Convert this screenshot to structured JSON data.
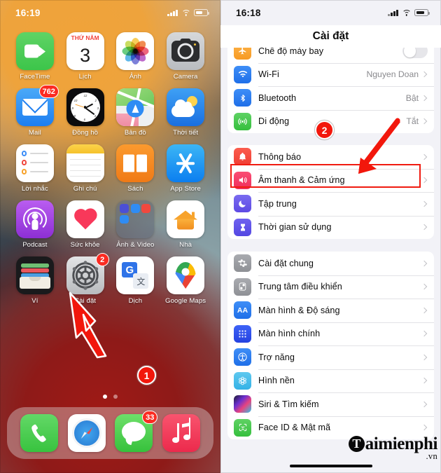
{
  "left_phone": {
    "status_bar": {
      "time": "16:19",
      "signal_icon": "cellular-signal-icon",
      "wifi_icon": "wifi-icon",
      "battery_icon": "battery-icon"
    },
    "apps": [
      {
        "label": "FaceTime",
        "icon": "facetime-icon",
        "badge": null
      },
      {
        "label": "Lịch",
        "icon": "calendar-icon",
        "badge": null,
        "cal_weekday": "THỨ NĂM",
        "cal_day": "3"
      },
      {
        "label": "Ảnh",
        "icon": "photos-icon",
        "badge": null
      },
      {
        "label": "Camera",
        "icon": "camera-icon",
        "badge": null
      },
      {
        "label": "Mail",
        "icon": "mail-icon",
        "badge": "762"
      },
      {
        "label": "Đồng hồ",
        "icon": "clock-icon",
        "badge": null
      },
      {
        "label": "Bản đồ",
        "icon": "maps-icon",
        "badge": null
      },
      {
        "label": "Thời tiết",
        "icon": "weather-icon",
        "badge": null
      },
      {
        "label": "Lời nhắc",
        "icon": "reminders-icon",
        "badge": null
      },
      {
        "label": "Ghi chú",
        "icon": "notes-icon",
        "badge": null
      },
      {
        "label": "Sách",
        "icon": "books-icon",
        "badge": null
      },
      {
        "label": "App Store",
        "icon": "app-store-icon",
        "badge": null
      },
      {
        "label": "Podcast",
        "icon": "podcasts-icon",
        "badge": null
      },
      {
        "label": "Sức khỏe",
        "icon": "health-icon",
        "badge": null
      },
      {
        "label": "Ảnh & Video",
        "icon": "folder-icon",
        "badge": null
      },
      {
        "label": "Nhà",
        "icon": "home-app-icon",
        "badge": null
      },
      {
        "label": "Ví",
        "icon": "wallet-icon",
        "badge": null
      },
      {
        "label": "Cài đặt",
        "icon": "settings-gear-icon",
        "badge": "2"
      },
      {
        "label": "Dịch",
        "icon": "translate-icon",
        "badge": null
      },
      {
        "label": "Google Maps",
        "icon": "google-maps-icon",
        "badge": null
      }
    ],
    "dock": [
      {
        "label": "Phone",
        "icon": "phone-icon",
        "badge": null
      },
      {
        "label": "Safari",
        "icon": "safari-icon",
        "badge": null
      },
      {
        "label": "Messages",
        "icon": "messages-icon",
        "badge": "33"
      },
      {
        "label": "Music",
        "icon": "music-icon",
        "badge": null
      }
    ],
    "page_dots": {
      "count": 2,
      "active": 1
    },
    "annotation": {
      "number": "1",
      "arrow": "red-arrow",
      "highlight_target": "Cài đặt"
    }
  },
  "right_phone": {
    "status_bar": {
      "time": "16:18",
      "signal_icon": "cellular-signal-icon",
      "wifi_icon": "wifi-icon",
      "battery_icon": "battery-icon"
    },
    "title": "Cài đặt",
    "groups": [
      {
        "rows": [
          {
            "label": "Chế độ máy bay",
            "icon": "airplane-icon",
            "value": "",
            "control": "toggle-off",
            "clipped": true
          },
          {
            "label": "Wi-Fi",
            "icon": "wifi-icon",
            "value": "Nguyen Doan",
            "control": "chevron"
          },
          {
            "label": "Bluetooth",
            "icon": "bluetooth-icon",
            "value": "Bật",
            "control": "chevron"
          },
          {
            "label": "Di động",
            "icon": "cellular-icon",
            "value": "Tắt",
            "control": "chevron"
          }
        ]
      },
      {
        "rows": [
          {
            "label": "Thông báo",
            "icon": "notifications-bell-icon",
            "value": "",
            "control": "chevron"
          },
          {
            "label": "Âm thanh & Cảm ứng",
            "icon": "sounds-haptics-icon",
            "value": "",
            "control": "chevron",
            "highlighted": true
          },
          {
            "label": "Tập trung",
            "icon": "focus-moon-icon",
            "value": "",
            "control": "chevron"
          },
          {
            "label": "Thời gian sử dụng",
            "icon": "screen-time-icon",
            "value": "",
            "control": "chevron"
          }
        ]
      },
      {
        "rows": [
          {
            "label": "Cài đặt chung",
            "icon": "general-gear-icon",
            "value": "",
            "control": "chevron"
          },
          {
            "label": "Trung tâm điều khiển",
            "icon": "control-center-icon",
            "value": "",
            "control": "chevron"
          },
          {
            "label": "Màn hình & Độ sáng",
            "icon": "display-brightness-icon",
            "value": "",
            "control": "chevron"
          },
          {
            "label": "Màn hình chính",
            "icon": "home-screen-icon",
            "value": "",
            "control": "chevron"
          },
          {
            "label": "Trợ năng",
            "icon": "accessibility-icon",
            "value": "",
            "control": "chevron"
          },
          {
            "label": "Hình nền",
            "icon": "wallpaper-icon",
            "value": "",
            "control": "chevron"
          },
          {
            "label": "Siri & Tìm kiếm",
            "icon": "siri-icon",
            "value": "",
            "control": "chevron"
          },
          {
            "label": "Face ID & Mật mã",
            "icon": "face-id-icon",
            "value": "",
            "control": "chevron"
          }
        ]
      }
    ],
    "annotation": {
      "number": "2",
      "arrow": "red-arrow",
      "highlight_target": "Âm thanh & Cảm ứng"
    }
  },
  "watermark": {
    "letter": "T",
    "text": "aimienphi",
    "suffix": ".vn"
  },
  "colors": {
    "accent_red": "#f2170c",
    "badge_red": "#fb2b22",
    "ios_blue": "#1f6fe8",
    "group_bg": "#ffffff",
    "page_bg": "#f2f2f7"
  }
}
